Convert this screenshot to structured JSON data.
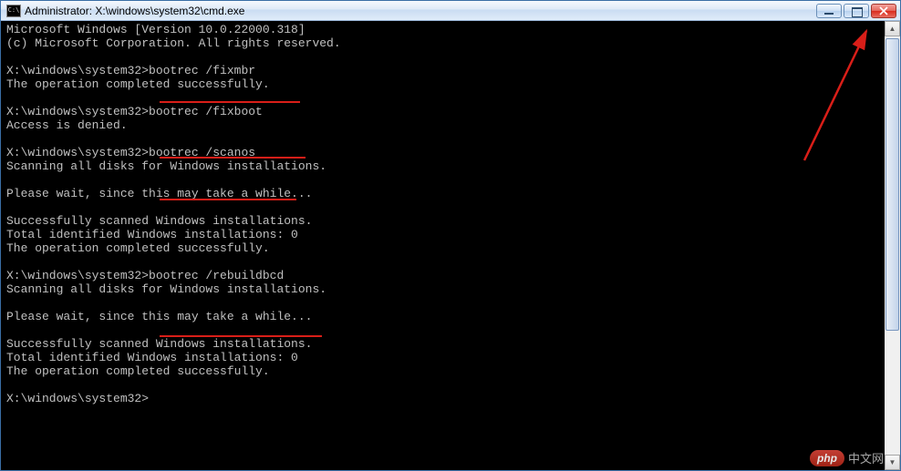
{
  "titlebar": {
    "icon_glyph": "C:\\",
    "title": "Administrator: X:\\windows\\system32\\cmd.exe"
  },
  "window_controls": {
    "minimize": "minimize",
    "maximize": "maximize",
    "close": "close"
  },
  "terminal": {
    "header_line1": "Microsoft Windows [Version 10.0.22000.318]",
    "header_line2": "(c) Microsoft Corporation. All rights reserved.",
    "blocks": [
      {
        "prompt": "X:\\windows\\system32>",
        "command": "bootrec /fixmbr",
        "output": [
          "The operation completed successfully."
        ]
      },
      {
        "prompt": "X:\\windows\\system32>",
        "command": "bootrec /fixboot",
        "output": [
          "Access is denied."
        ]
      },
      {
        "prompt": "X:\\windows\\system32>",
        "command": "bootrec /scanos",
        "output": [
          "Scanning all disks for Windows installations.",
          "",
          "Please wait, since this may take a while...",
          "",
          "Successfully scanned Windows installations.",
          "Total identified Windows installations: 0",
          "The operation completed successfully."
        ]
      },
      {
        "prompt": "X:\\windows\\system32>",
        "command": "bootrec /rebuildbcd",
        "output": [
          "Scanning all disks for Windows installations.",
          "",
          "Please wait, since this may take a while...",
          "",
          "Successfully scanned Windows installations.",
          "Total identified Windows installations: 0",
          "The operation completed successfully."
        ]
      },
      {
        "prompt": "X:\\windows\\system32>",
        "command": "",
        "output": []
      }
    ]
  },
  "annotations": {
    "underlines": [
      "bootrec /fixmbr",
      "bootrec /fixboot",
      "bootrec /scanos",
      "bootrec /rebuildbcd"
    ],
    "arrow_target": "close-button",
    "arrow_color": "#d91e18"
  },
  "watermark": {
    "badge": "php",
    "text": "中文网"
  }
}
